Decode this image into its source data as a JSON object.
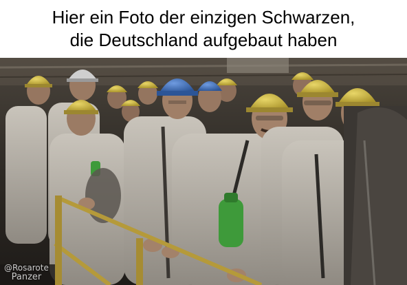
{
  "meme": {
    "caption_lines": [
      "Hier ein Foto der einzigen Schwarzen,",
      "die Deutschland aufgebaut haben"
    ]
  },
  "photo": {
    "subject": "coal-miners-group",
    "colors": {
      "tunnel_dark": "#3a3530",
      "helmet_yellow": "#c9b33a",
      "helmet_blue": "#3f6fb5",
      "overall_grey": "#b8b3ab",
      "skin": "#9c7a62",
      "bottle_green": "#3e9a3a",
      "rail_yellow": "#b59a3a"
    }
  },
  "watermark": {
    "line1": "@Rosarote",
    "line2": "Panzer"
  }
}
